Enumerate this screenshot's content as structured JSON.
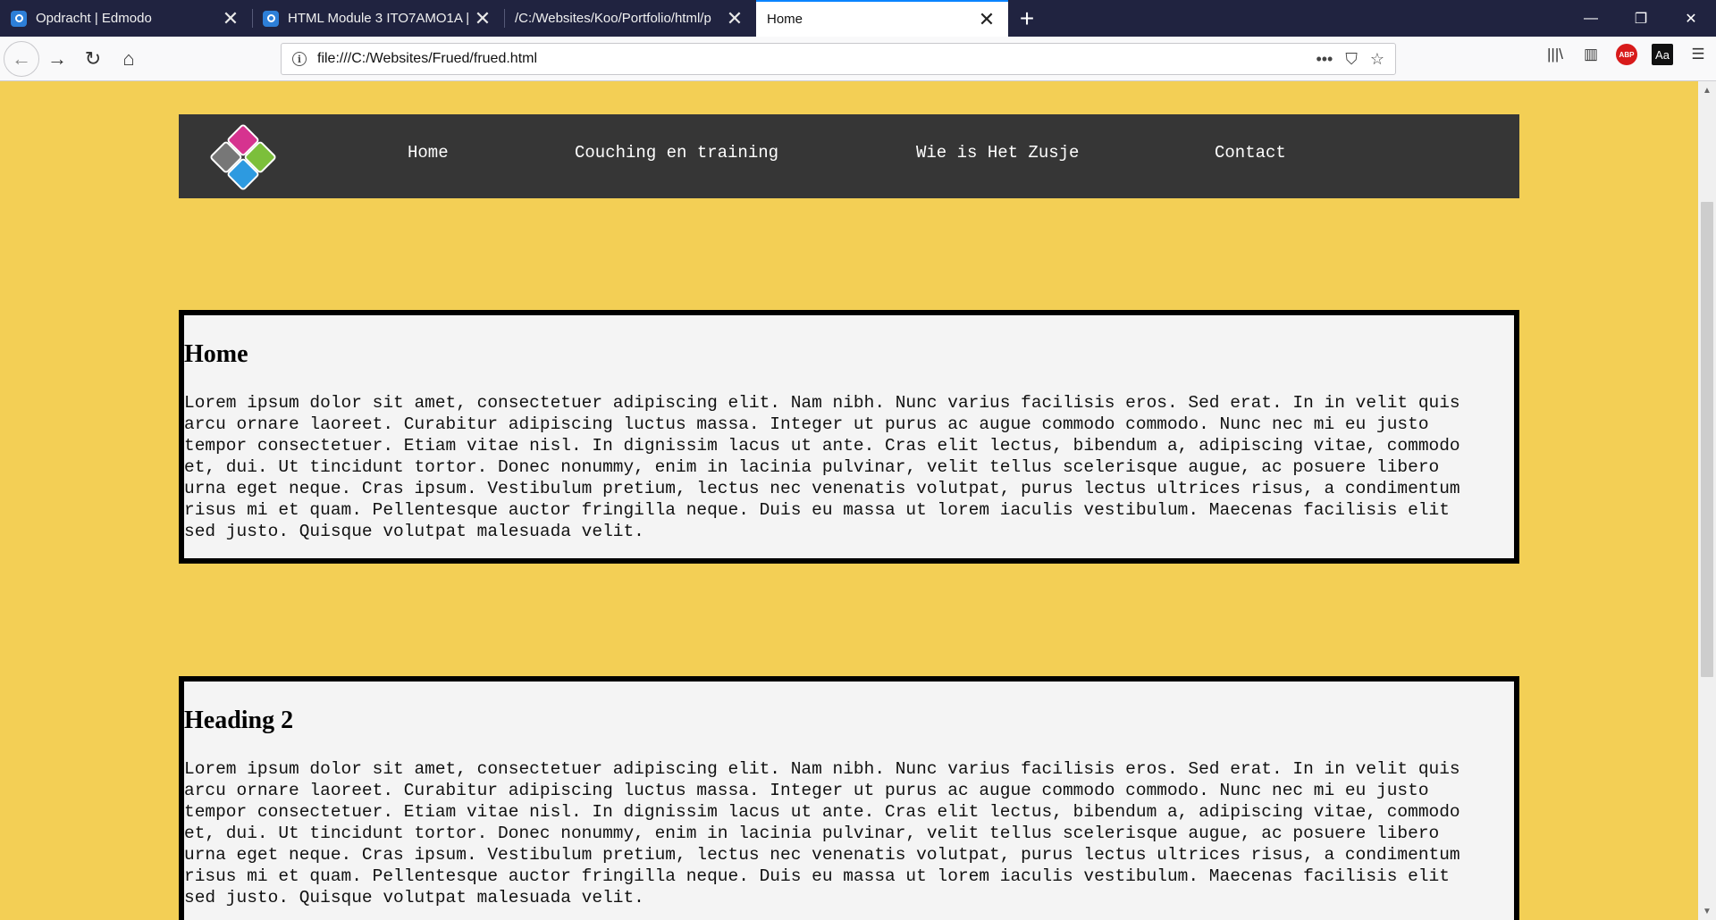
{
  "browser": {
    "tabs": [
      {
        "title": "Opdracht | Edmodo",
        "active": false,
        "has_favicon": true
      },
      {
        "title": "HTML Module 3 ITO7AMO1A |",
        "active": false,
        "has_favicon": true
      },
      {
        "title": "/C:/Websites/Koo/Portfolio/html/p",
        "active": false,
        "has_favicon": false
      },
      {
        "title": "Home",
        "active": true,
        "has_favicon": false
      }
    ],
    "new_tab_glyph": "+",
    "close_glyph": "✕",
    "window_controls": {
      "minimize": "—",
      "restore": "❐",
      "close": "✕"
    },
    "url": "file:///C:/Websites/Frued/frued.html",
    "url_actions": {
      "more": "•••",
      "pocket": "⛉",
      "bookmark": "☆"
    },
    "nav_glyphs": {
      "back": "←",
      "forward": "→",
      "reload": "↻",
      "home": "⌂"
    },
    "toolbar_glyphs": {
      "library": "|||\\",
      "sidebar": "▥",
      "adblock": "ABP",
      "dictionary": "Aa",
      "menu": "☰"
    }
  },
  "site": {
    "nav": [
      "Home",
      "Couching en training",
      "Wie is Het Zusje",
      "Contact"
    ],
    "logo_colors": [
      "#d6338f",
      "#7cbf3b",
      "#2d9ae0",
      "#777777"
    ]
  },
  "sections": [
    {
      "heading": "Home",
      "body": "Lorem ipsum dolor sit amet, consectetuer adipiscing elit. Nam nibh. Nunc varius facilisis eros. Sed erat. In in velit quis arcu ornare laoreet. Curabitur adipiscing luctus massa. Integer ut purus ac augue commodo commodo. Nunc nec mi eu justo tempor consectetuer. Etiam vitae nisl. In dignissim lacus ut ante. Cras elit lectus, bibendum a, adipiscing vitae, commodo et, dui. Ut tincidunt tortor. Donec nonummy, enim in lacinia pulvinar, velit tellus scelerisque augue, ac posuere libero urna eget neque. Cras ipsum. Vestibulum pretium, lectus nec venenatis volutpat, purus lectus ultrices risus, a condimentum risus mi et quam. Pellentesque auctor fringilla neque. Duis eu massa ut lorem iaculis vestibulum. Maecenas facilisis elit sed justo. Quisque volutpat malesuada velit."
    },
    {
      "heading": "Heading 2",
      "body": "Lorem ipsum dolor sit amet, consectetuer adipiscing elit. Nam nibh. Nunc varius facilisis eros. Sed erat. In in velit quis arcu ornare laoreet. Curabitur adipiscing luctus massa. Integer ut purus ac augue commodo commodo. Nunc nec mi eu justo tempor consectetuer. Etiam vitae nisl. In dignissim lacus ut ante. Cras elit lectus, bibendum a, adipiscing vitae, commodo et, dui. Ut tincidunt tortor. Donec nonummy, enim in lacinia pulvinar, velit tellus scelerisque augue, ac posuere libero urna eget neque. Cras ipsum. Vestibulum pretium, lectus nec venenatis volutpat, purus lectus ultrices risus, a condimentum risus mi et quam. Pellentesque auctor fringilla neque. Duis eu massa ut lorem iaculis vestibulum. Maecenas facilisis elit sed justo. Quisque volutpat malesuada velit."
    }
  ],
  "colors": {
    "page_background": "#f3cf55",
    "header_background": "#363636",
    "card_background": "#f4f4f4",
    "tabbar_background": "#202340",
    "active_tab_accent": "#0a84ff"
  }
}
